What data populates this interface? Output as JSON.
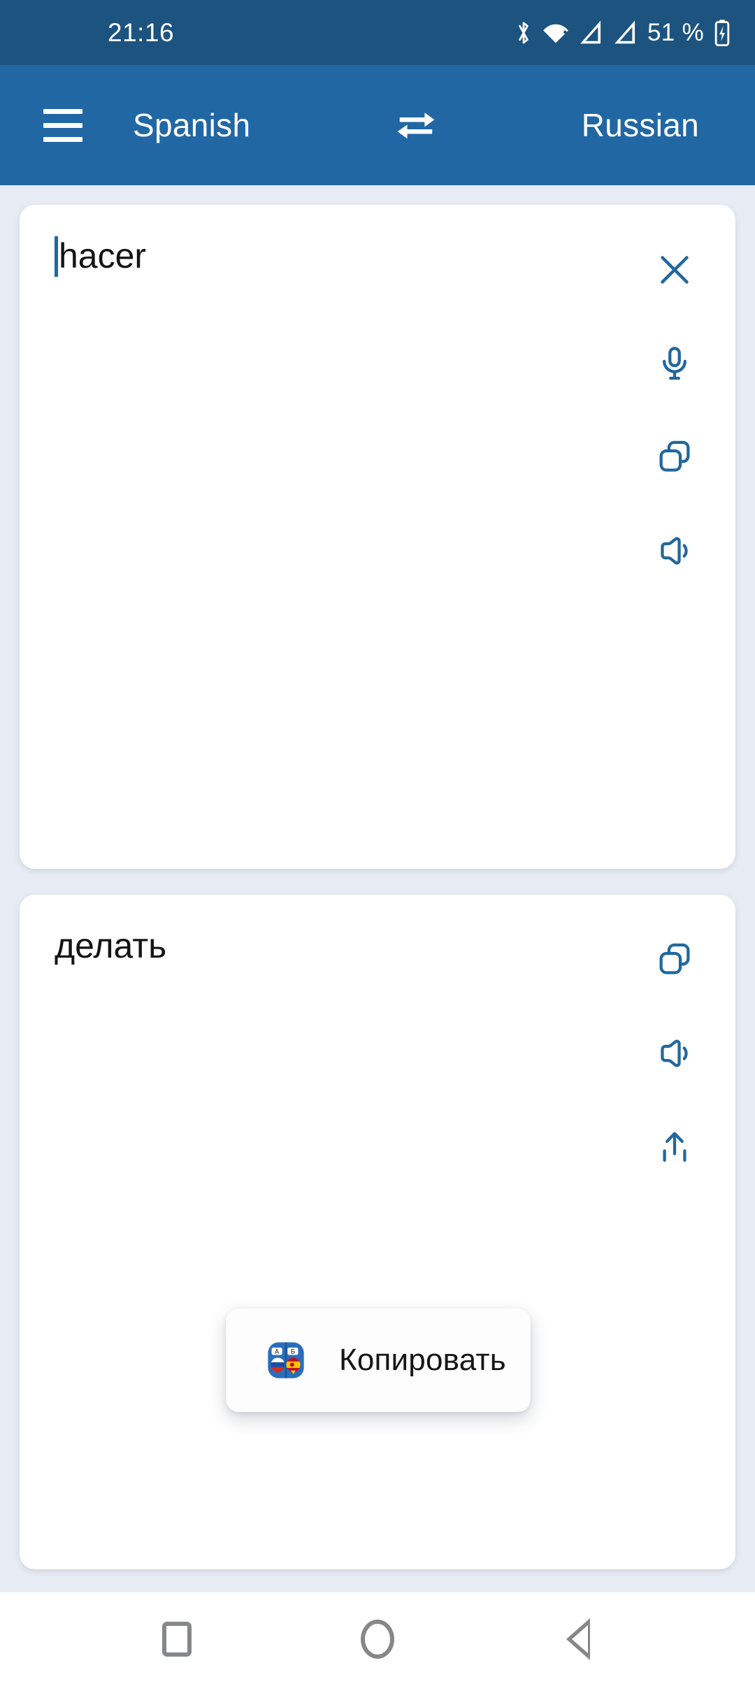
{
  "status_bar": {
    "time": "21:16",
    "battery_percent": "51 %",
    "icons": [
      "bluetooth-icon",
      "wifi-icon",
      "signal-sim1-icon",
      "signal-sim2-icon",
      "battery-charging-icon"
    ],
    "background_color": "#1c537f"
  },
  "app_bar": {
    "menu_label": "menu",
    "source_language": "Spanish",
    "target_language": "Russian",
    "swap_label": "swap-languages",
    "background_color": "#2167a4",
    "text_color": "#ffffff"
  },
  "source_card": {
    "text": "hacer",
    "has_caret": true,
    "actions": [
      {
        "name": "clear-button",
        "icon": "close-icon",
        "label": "Clear"
      },
      {
        "name": "voice-input-button",
        "icon": "microphone-icon",
        "label": "Voice input"
      },
      {
        "name": "copy-source-button",
        "icon": "copy-icon",
        "label": "Copy"
      },
      {
        "name": "speak-source-button",
        "icon": "speaker-icon",
        "label": "Listen"
      }
    ]
  },
  "target_card": {
    "text": "делать",
    "actions": [
      {
        "name": "copy-target-button",
        "icon": "copy-icon",
        "label": "Copy"
      },
      {
        "name": "speak-target-button",
        "icon": "speaker-icon",
        "label": "Listen"
      },
      {
        "name": "share-target-button",
        "icon": "share-icon",
        "label": "Share"
      }
    ]
  },
  "popup": {
    "label": "Копировать",
    "icon": "translator-app-icon"
  },
  "nav_bar": {
    "recents_label": "Recents",
    "home_label": "Home",
    "back_label": "Back"
  },
  "theme": {
    "accent": "#22679e",
    "page_background": "#e8edf5",
    "card_background": "#ffffff"
  }
}
